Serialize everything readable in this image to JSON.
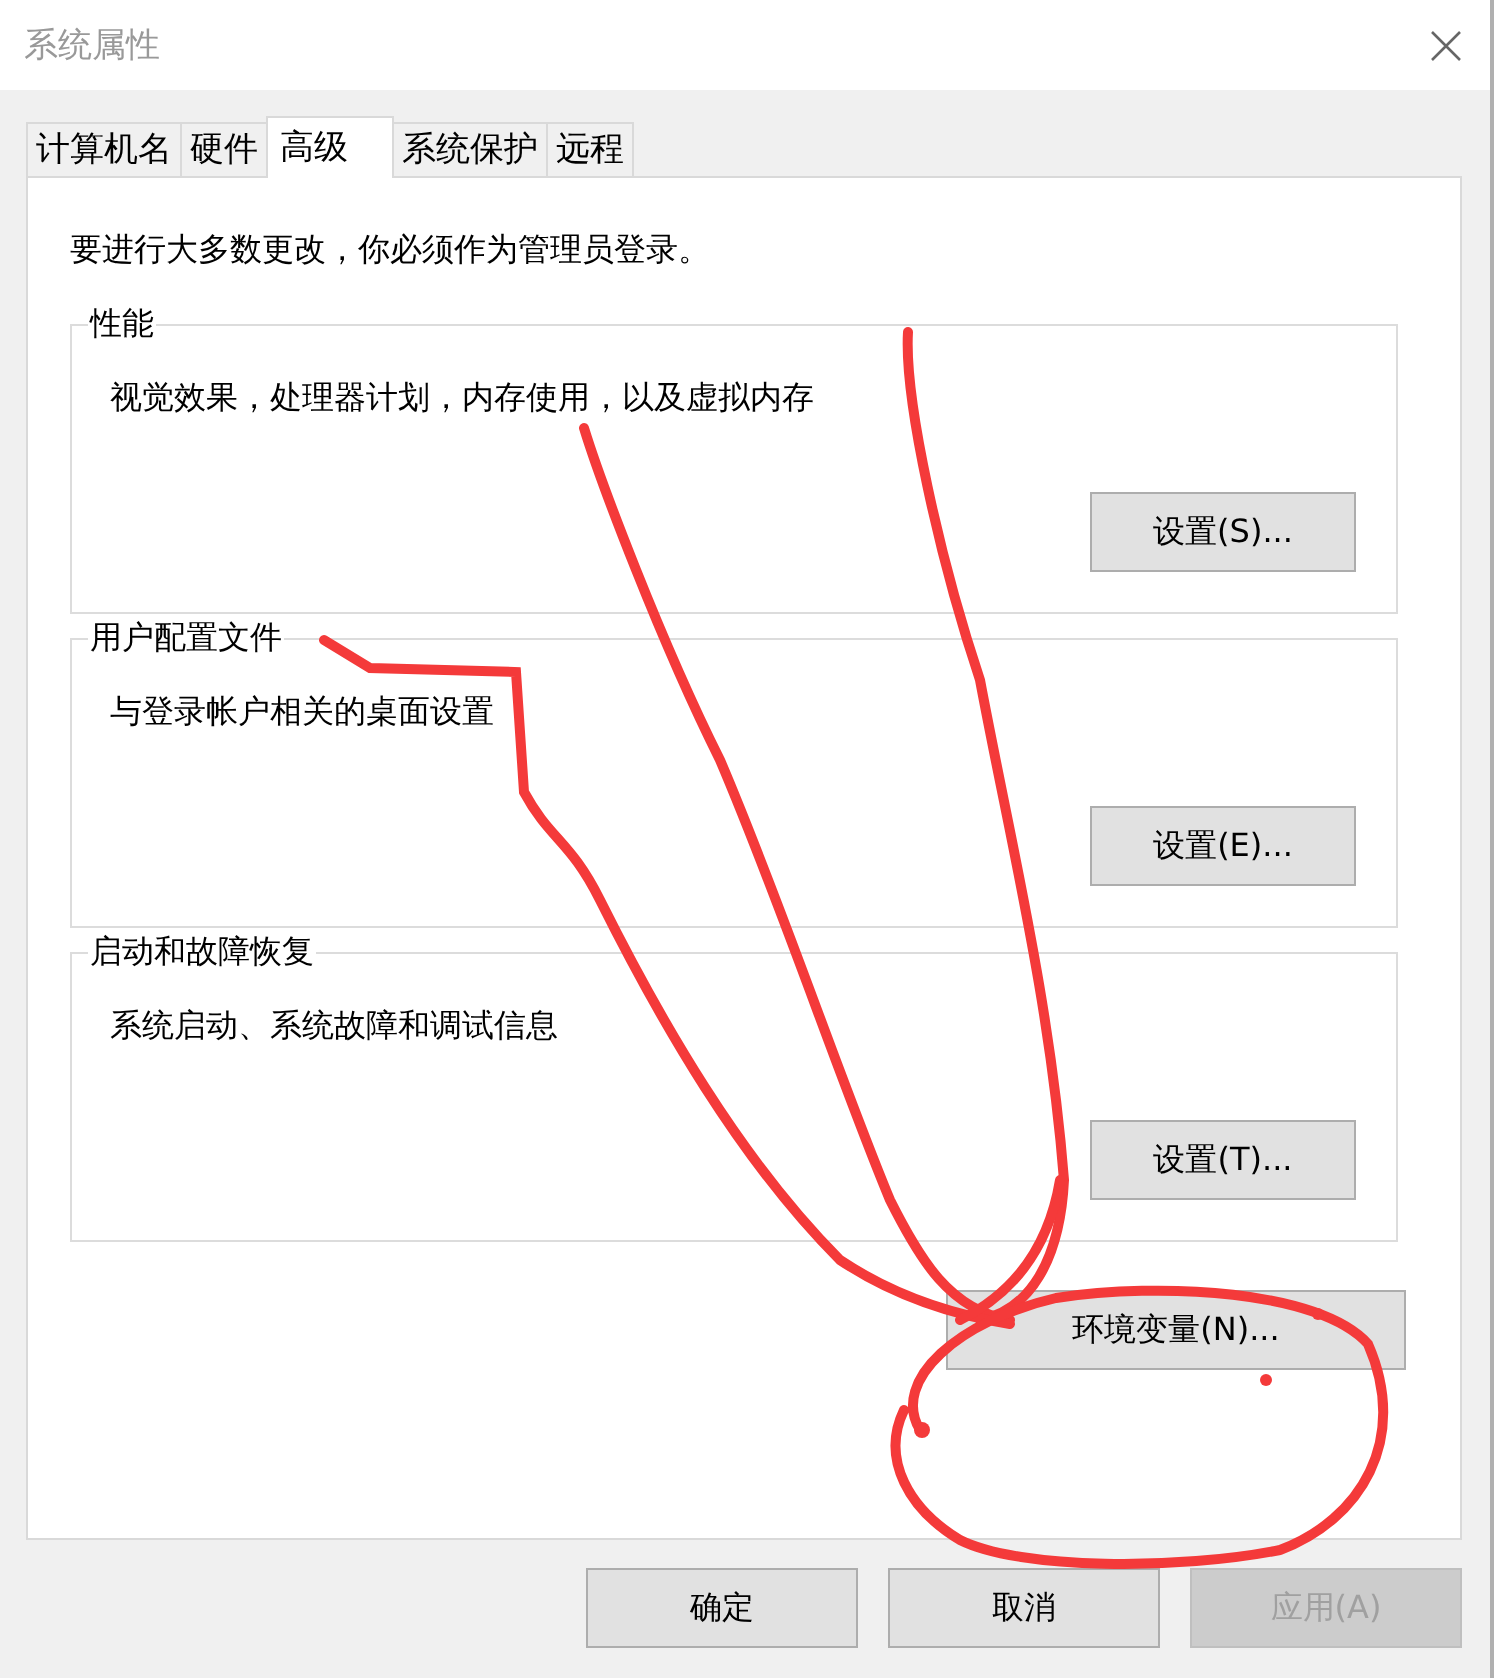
{
  "window": {
    "title": "系统属性"
  },
  "tabs": [
    {
      "label": "计算机名",
      "selected": false
    },
    {
      "label": "硬件",
      "selected": false
    },
    {
      "label": "高级",
      "selected": true
    },
    {
      "label": "系统保护",
      "selected": false
    },
    {
      "label": "远程",
      "selected": false
    }
  ],
  "notice": "要进行大多数更改，你必须作为管理员登录。",
  "groups": [
    {
      "title": "性能",
      "description": "视觉效果，处理器计划，内存使用，以及虚拟内存",
      "button": "设置(S)..."
    },
    {
      "title": "用户配置文件",
      "description": "与登录帐户相关的桌面设置",
      "button": "设置(E)..."
    },
    {
      "title": "启动和故障恢复",
      "description": "系统启动、系统故障和调试信息",
      "button": "设置(T)..."
    }
  ],
  "environment_button": "环境变量(N)...",
  "footer_buttons": [
    {
      "label": "确定",
      "disabled": false
    },
    {
      "label": "取消",
      "disabled": false
    },
    {
      "label": "应用(A)",
      "disabled": true
    }
  ]
}
